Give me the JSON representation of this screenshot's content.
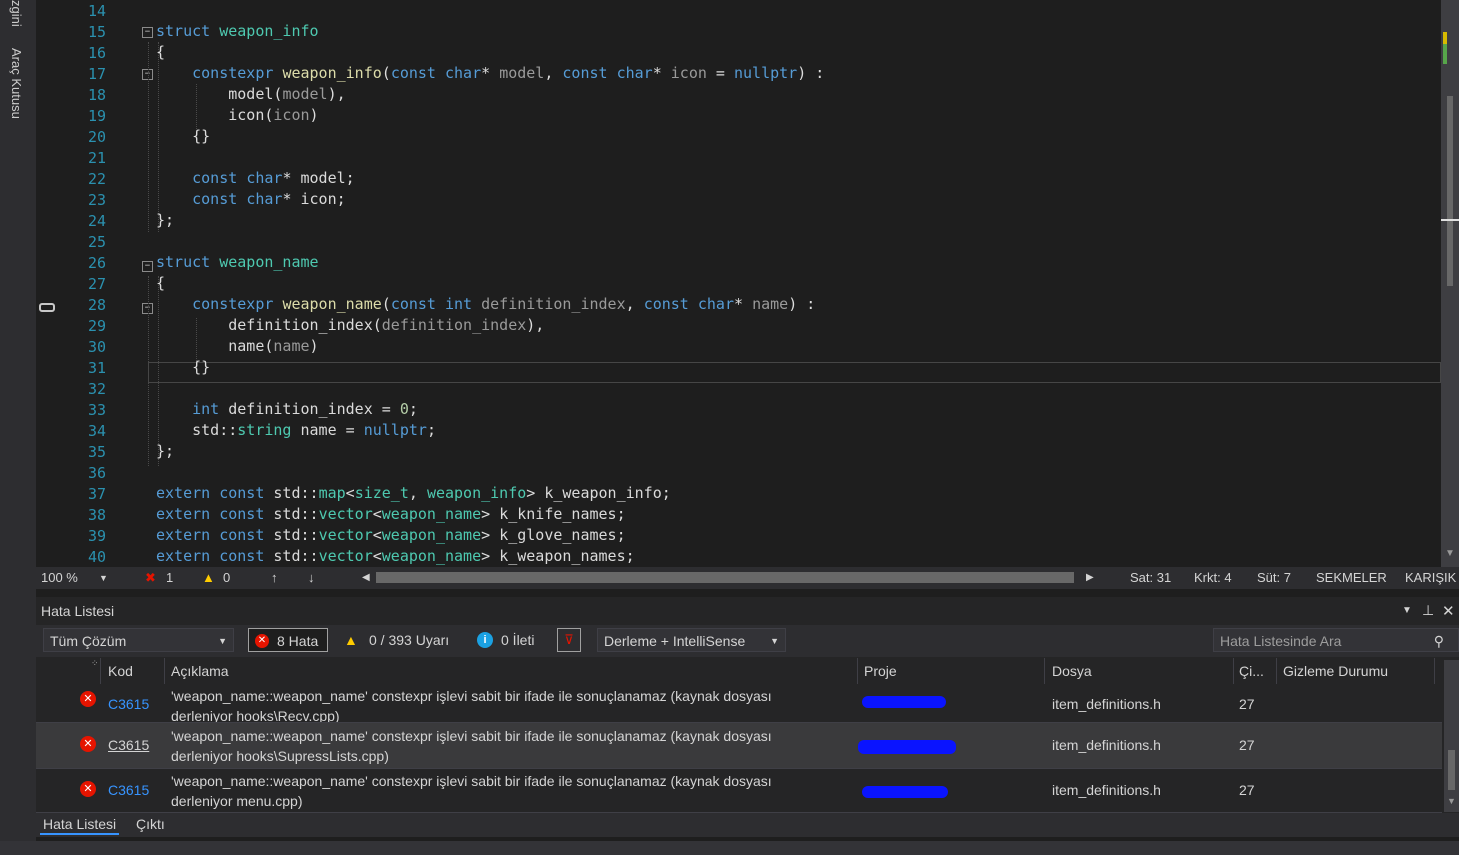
{
  "side_tabs": [
    "zgini",
    "Araç Kutusu"
  ],
  "editor": {
    "line_numbers": [
      "14",
      "15",
      "16",
      "17",
      "18",
      "19",
      "20",
      "21",
      "22",
      "23",
      "24",
      "25",
      "26",
      "27",
      "28",
      "29",
      "30",
      "31",
      "32",
      "33",
      "34",
      "35",
      "36",
      "37",
      "38",
      "39",
      "40"
    ],
    "lines": [
      "",
      "struct weapon_info",
      "{",
      "    constexpr weapon_info(const char* model, const char* icon = nullptr) :",
      "        model(model),",
      "        icon(icon)",
      "    {}",
      "",
      "    const char* model;",
      "    const char* icon;",
      "};",
      "",
      "struct weapon_name",
      "{",
      "    constexpr weapon_name(const int definition_index, const char* name) :",
      "        definition_index(definition_index),",
      "        name(name)",
      "    {}",
      "",
      "    int definition_index = 0;",
      "    std::string name = nullptr;",
      "};",
      "",
      "extern const std::map<size_t, weapon_info> k_weapon_info;",
      "extern const std::vector<weapon_name> k_knife_names;",
      "extern const std::vector<weapon_name> k_glove_names;",
      "extern const std::vector<weapon_name> k_weapon_names;"
    ]
  },
  "status_bar": {
    "zoom": "100 %",
    "errors": "1",
    "warnings": "0",
    "line": "Sat: 31",
    "char": "Krkt: 4",
    "col": "Süt: 7",
    "tabs": "SEKMELER",
    "eol": "KARIŞIK"
  },
  "error_list": {
    "title": "Hata Listesi",
    "scope": "Tüm Çözüm",
    "errors_btn": "8 Hata",
    "warnings_btn": "0 / 393 Uyarı",
    "messages_btn": "0 İleti",
    "build_filter": "Derleme + IntelliSense",
    "search_placeholder": "Hata Listesinde Ara",
    "columns": {
      "code": "Kod",
      "description": "Açıklama",
      "project": "Proje",
      "file": "Dosya",
      "line": "Çi...",
      "suppression": "Gizleme Durumu"
    },
    "rows": [
      {
        "code": "C3615",
        "desc1": "'weapon_name::weapon_name' constexpr işlevi sabit bir ifade ile sonuçlanamaz (kaynak dosyası",
        "desc2": "derleniyor hooks\\Recv.cpp)",
        "file": "item_definitions.h",
        "line": "27"
      },
      {
        "code": "C3615",
        "desc1": "'weapon_name::weapon_name' constexpr işlevi sabit bir ifade ile sonuçlanamaz (kaynak dosyası",
        "desc2": "derleniyor hooks\\SupressLists.cpp)",
        "file": "item_definitions.h",
        "line": "27"
      },
      {
        "code": "C3615",
        "desc1": "'weapon_name::weapon_name' constexpr işlevi sabit bir ifade ile sonuçlanamaz (kaynak dosyası",
        "desc2": "derleniyor menu.cpp)",
        "file": "item_definitions.h",
        "line": "27"
      }
    ]
  },
  "bottom_tabs": [
    "Hata Listesi",
    "Çıktı"
  ],
  "colors": {
    "error": "#e51400",
    "warning": "#ffcc00",
    "info": "#1ba1e2",
    "accent": "#3794ff"
  }
}
